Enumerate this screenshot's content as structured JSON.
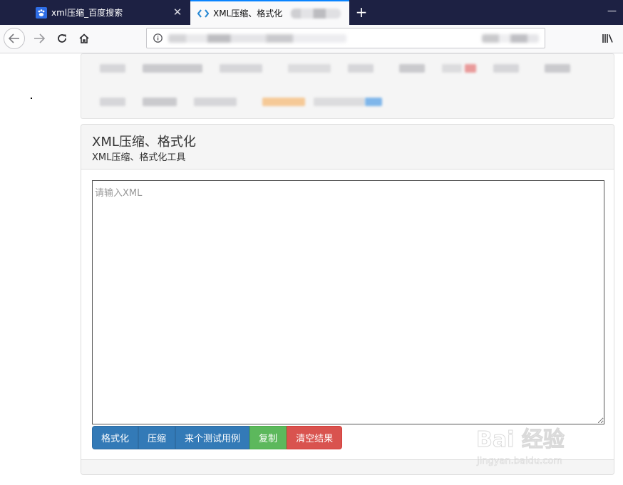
{
  "tabs": [
    {
      "title": "xml压缩_百度搜索",
      "active": false
    },
    {
      "title": "XML压缩、格式化",
      "active": true
    }
  ],
  "panel": {
    "title": "XML压缩、格式化",
    "subtitle": "XML压缩、格式化工具"
  },
  "input": {
    "placeholder": "请输入XML",
    "value": ""
  },
  "buttons": {
    "format": "格式化",
    "compress": "压缩",
    "sample": "来个测试用例",
    "copy": "复制",
    "clear": "清空结果"
  },
  "colors": {
    "primary": "#337ab7",
    "success": "#5cb85c",
    "danger": "#d9534f",
    "tabbar": "#1d2143",
    "active_tab_accent": "#0a84ff"
  },
  "watermark": {
    "logo_text": "Bai 经验",
    "url": "jingyan.baidu.com"
  }
}
